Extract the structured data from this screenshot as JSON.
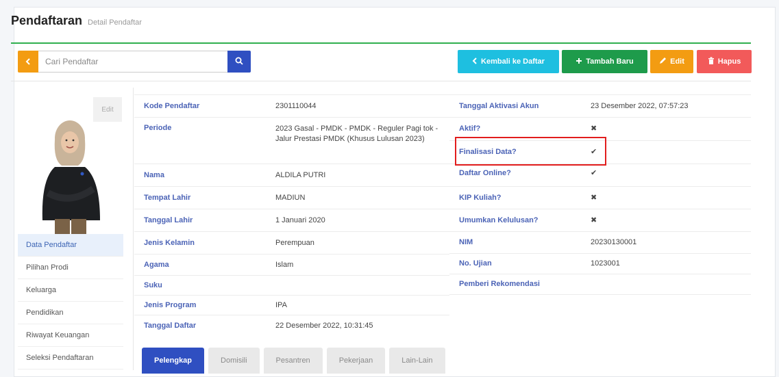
{
  "header": {
    "title": "Pendaftaran",
    "subtitle": "Detail Pendaftar"
  },
  "search": {
    "placeholder": "Cari Pendaftar",
    "prefix_icon": "chevron-left-icon",
    "button_icon": "search-icon"
  },
  "actions": {
    "back": "Kembali ke Daftar",
    "add": "Tambah Baru",
    "edit": "Edit",
    "delete": "Hapus"
  },
  "photo": {
    "edit_label": "Edit"
  },
  "side_nav": [
    "Data Pendaftar",
    "Pilihan Prodi",
    "Keluarga",
    "Pendidikan",
    "Riwayat Keuangan",
    "Seleksi Pendaftaran"
  ],
  "details_left": [
    {
      "label": "Kode Pendaftar",
      "value": "2301110044"
    },
    {
      "label": "Periode",
      "value": "2023 Gasal - PMDK - PMDK - Reguler Pagi tok - Jalur Prestasi PMDK (Khusus Lulusan 2023)"
    },
    {
      "label": "Nama",
      "value": "ALDILA PUTRI"
    },
    {
      "label": "Tempat Lahir",
      "value": "MADIUN"
    },
    {
      "label": "Tanggal Lahir",
      "value": "1 Januari 2020"
    },
    {
      "label": "Jenis Kelamin",
      "value": "Perempuan"
    },
    {
      "label": "Agama",
      "value": "Islam"
    },
    {
      "label": "Suku",
      "value": ""
    },
    {
      "label": "Jenis Program",
      "value": "IPA"
    },
    {
      "label": "Tanggal Daftar",
      "value": "22 Desember 2022, 10:31:45"
    }
  ],
  "details_right": [
    {
      "label": "Tanggal Aktivasi Akun",
      "value": "23 Desember 2022, 07:57:23"
    },
    {
      "label": "Aktif?",
      "value": "✖"
    },
    {
      "label": "Finalisasi Data?",
      "value": "✔"
    },
    {
      "label": "Daftar Online?",
      "value": "✔"
    },
    {
      "label": "KIP Kuliah?",
      "value": "✖"
    },
    {
      "label": "Umumkan Kelulusan?",
      "value": "✖"
    },
    {
      "label": "NIM",
      "value": "20230130001"
    },
    {
      "label": "No. Ujian",
      "value": "1023001"
    },
    {
      "label": "Pemberi Rekomendasi",
      "value": ""
    }
  ],
  "tabs": [
    "Pelengkap",
    "Domisili",
    "Pesantren",
    "Pekerjaan",
    "Lain-Lain"
  ],
  "colors": {
    "accent": "#2f4fc1",
    "header_line": "#2eaf4e",
    "highlight": "#e21d1d"
  }
}
